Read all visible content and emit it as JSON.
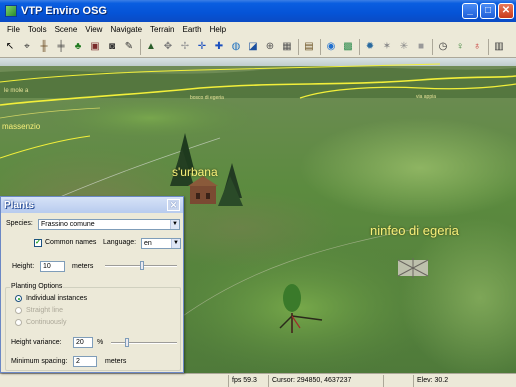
{
  "window": {
    "title": "VTP Enviro OSG",
    "controls": {
      "minimize": "_",
      "maximize": "□",
      "close": "✕"
    }
  },
  "menu": [
    "File",
    "Tools",
    "Scene",
    "View",
    "Navigate",
    "Terrain",
    "Earth",
    "Help"
  ],
  "toolbar": {
    "icons": [
      "pointer-icon",
      "crosshair-icon",
      "fence-icon",
      "road-icon",
      "tree-icon",
      "building-icon",
      "camera-icon",
      "pen-icon",
      "terrain-profile-icon",
      "move-icon",
      "move-object-icon",
      "navigate-icon",
      "navigate-alt-icon",
      "globe-icon",
      "layers-icon",
      "move-points-icon",
      "tile-icon",
      "paste-icon",
      "globe-view-icon",
      "map-view-icon",
      "sun-icon",
      "spaceship-icon",
      "snowflake-icon",
      "grey-box-icon",
      "clock-icon",
      "vertical-exag-icon",
      "lightbulb-icon",
      "chart-icon"
    ]
  },
  "viewport": {
    "labels": {
      "surbana": "s'urbana",
      "ninfeo": "ninfeo di egeria",
      "massenzio": "massenzio",
      "small_left": "le mole a",
      "small_mid": "bosco di egeria",
      "small_right": "via appia"
    },
    "colors": {
      "sky": "#d9e2e3",
      "grass": "#5c8b3f",
      "road": "#f2ef3a",
      "label": "#f7f07a"
    }
  },
  "status": {
    "fps": "fps 59.3",
    "cursor": "Cursor: 294850, 4637237",
    "empty": "",
    "elev": "Elev: 30.2"
  },
  "plants": {
    "title": "Plants",
    "species_label": "Species:",
    "species_value": "Frassino comune",
    "common_names_label": "Common names",
    "common_names_checked": true,
    "language_label": "Language:",
    "language_value": "en",
    "height_label": "Height:",
    "height_value": "10",
    "height_unit": "meters",
    "planting_options_label": "Planting Options",
    "option_individual": "Individual instances",
    "option_straight": "Straight line",
    "option_continuous": "Continuously",
    "height_variance_label": "Height variance:",
    "height_variance_value": "20",
    "height_variance_unit": "%",
    "min_spacing_label": "Minimum spacing:",
    "min_spacing_value": "2",
    "min_spacing_unit": "meters"
  }
}
